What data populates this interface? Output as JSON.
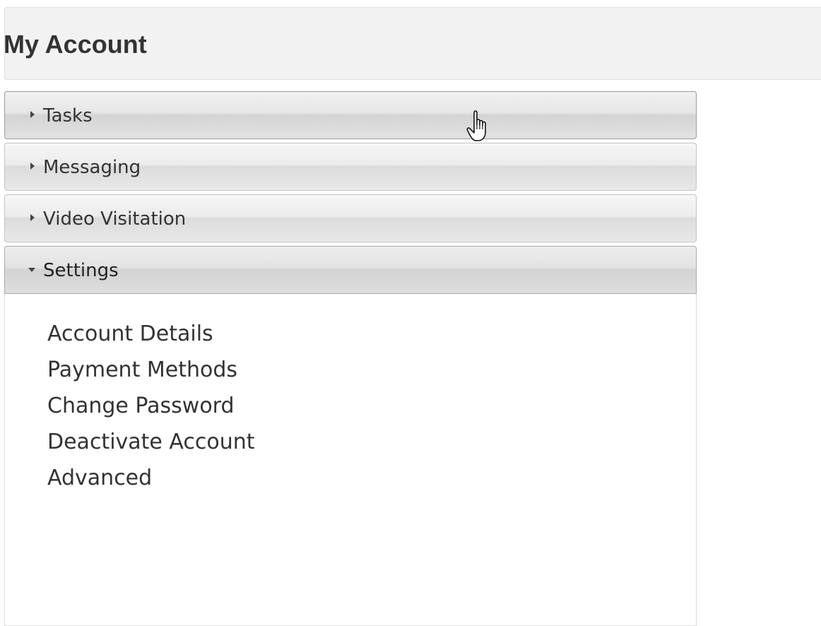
{
  "page": {
    "title": "My Account"
  },
  "accordion": {
    "sections": [
      {
        "label": "Tasks",
        "expanded": false
      },
      {
        "label": "Messaging",
        "expanded": false
      },
      {
        "label": "Video Visitation",
        "expanded": false
      },
      {
        "label": "Settings",
        "expanded": true
      }
    ]
  },
  "settings": {
    "items": [
      "Account Details",
      "Payment Methods",
      "Change Password",
      "Deactivate Account",
      "Advanced"
    ]
  },
  "icons": {
    "collapsed": "triangle-right-icon",
    "expanded": "triangle-down-icon",
    "cursor": "hand-pointer-icon"
  },
  "colors": {
    "header_bg": "#f2f2f2",
    "text": "#333333",
    "accordion_border": "#c5c5c5"
  }
}
